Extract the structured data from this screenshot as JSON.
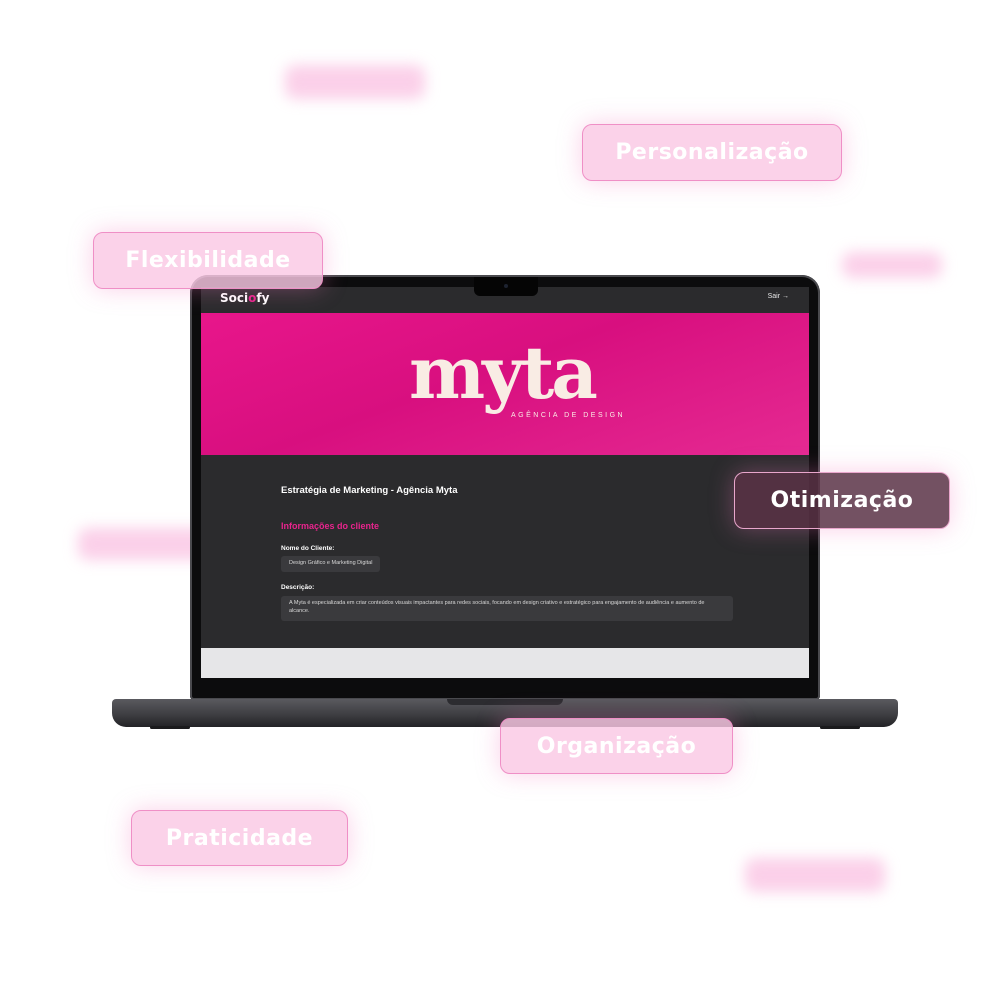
{
  "features": {
    "personalizacao": "Personalização",
    "flexibilidade": "Flexibilidade",
    "otimizacao": "Otimização",
    "organizacao": "Organização",
    "praticidade": "Praticidade"
  },
  "app": {
    "logo_main": "Soci",
    "logo_dot": "o",
    "logo_end": "fy",
    "logout_label": "Sair →"
  },
  "banner": {
    "brand": "myta",
    "tagline": "AGÊNCIA DE DESIGN"
  },
  "project": {
    "title": "Estratégia de Marketing - Agência Myta",
    "section_title": "Informações do cliente",
    "client_name_label": "Nome do Cliente:",
    "client_name_value": "Design Gráfico e Marketing Digital",
    "description_label": "Descrição:",
    "description_value": "A Myta é especializada em criar conteúdos visuais impactantes para redes sociais, focando em design criativo e estratégico para engajamento de audiência e aumento de alcance."
  },
  "colors": {
    "accent": "#e9248d",
    "pill_bg": "#fac8e4",
    "screen_bg": "#2b2b2d"
  }
}
